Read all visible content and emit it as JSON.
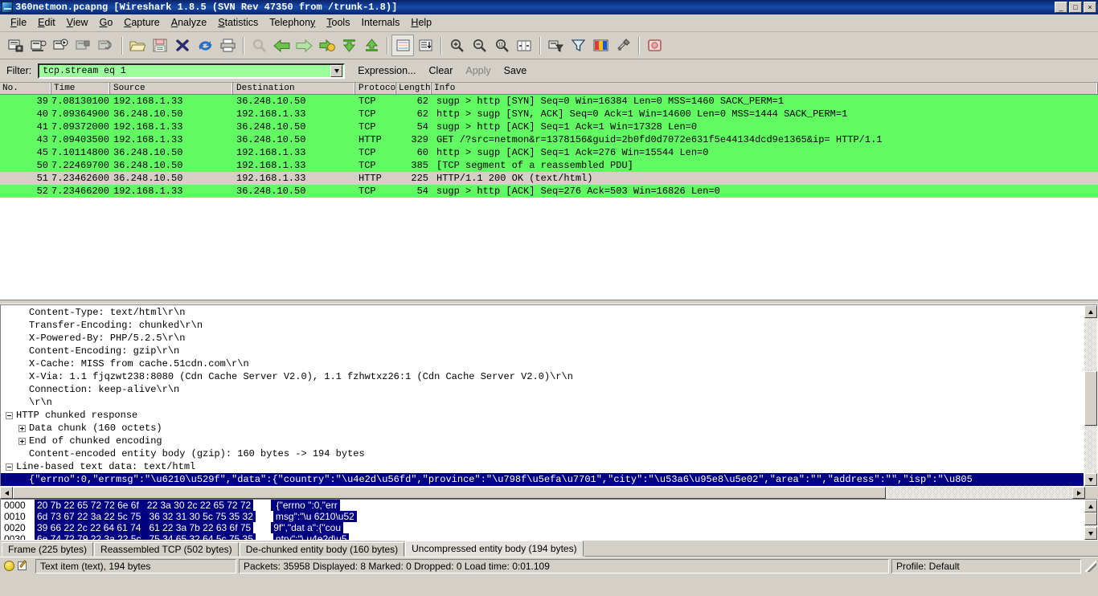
{
  "window": {
    "title": "360netmon.pcapng   [Wireshark 1.8.5  (SVN Rev 47350 from /trunk-1.8)]",
    "minimize_label": "_",
    "maximize_label": "□",
    "close_label": "×"
  },
  "menu": {
    "items": [
      {
        "label": "File",
        "accel": "F"
      },
      {
        "label": "Edit",
        "accel": "E"
      },
      {
        "label": "View",
        "accel": "V"
      },
      {
        "label": "Go",
        "accel": "G"
      },
      {
        "label": "Capture",
        "accel": "C"
      },
      {
        "label": "Analyze",
        "accel": "A"
      },
      {
        "label": "Statistics",
        "accel": "S"
      },
      {
        "label": "Telephony",
        "accel": "T"
      },
      {
        "label": "Tools",
        "accel": "T"
      },
      {
        "label": "Internals",
        "accel": "I"
      },
      {
        "label": "Help",
        "accel": "H"
      }
    ]
  },
  "toolbar": {
    "buttons": [
      {
        "name": "interfaces-icon",
        "title": "List the available capture interfaces"
      },
      {
        "name": "capture-options-icon",
        "title": "Show the capture options"
      },
      {
        "name": "start-capture-icon",
        "title": "Start a new live capture"
      },
      {
        "name": "stop-capture-icon",
        "title": "Stop the running live capture"
      },
      {
        "name": "restart-capture-icon",
        "title": "Restart the running live capture"
      },
      {
        "name": "open-file-icon",
        "title": "Open a capture file"
      },
      {
        "name": "save-file-icon",
        "title": "Save this capture file"
      },
      {
        "name": "close-file-icon",
        "title": "Close this capture file"
      },
      {
        "name": "reload-icon",
        "title": "Reload this capture file"
      },
      {
        "name": "print-icon",
        "title": "Print packets"
      },
      {
        "name": "find-packet-icon",
        "title": "Find a packet"
      },
      {
        "name": "go-back-icon",
        "title": "Go back in packet history"
      },
      {
        "name": "go-forward-icon",
        "title": "Go forward in packet history"
      },
      {
        "name": "go-to-packet-icon",
        "title": "Go to a specific packet"
      },
      {
        "name": "go-first-packet-icon",
        "title": "Go to the first packet"
      },
      {
        "name": "go-last-packet-icon",
        "title": "Go to the last packet"
      },
      {
        "name": "colorize-icon",
        "title": "Colorize packet list"
      },
      {
        "name": "auto-scroll-icon",
        "title": "Auto scroll in live capture"
      },
      {
        "name": "zoom-in-icon",
        "title": "Zoom in"
      },
      {
        "name": "zoom-out-icon",
        "title": "Zoom out"
      },
      {
        "name": "zoom-reset-icon",
        "title": "Normal size"
      },
      {
        "name": "resize-columns-icon",
        "title": "Resize columns"
      },
      {
        "name": "capture-filters-icon",
        "title": "Edit capture filters"
      },
      {
        "name": "display-filters-icon",
        "title": "Edit display filters"
      },
      {
        "name": "coloring-rules-icon",
        "title": "Coloring rules"
      },
      {
        "name": "preferences-icon",
        "title": "Preferences"
      },
      {
        "name": "help-icon",
        "title": "Help contents"
      }
    ]
  },
  "filter": {
    "label": "Filter:",
    "value": "tcp.stream eq 1",
    "placeholder": "",
    "dropdown_icon": "chevron-down-icon",
    "expression_label": "Expression...",
    "clear_label": "Clear",
    "apply_label": "Apply",
    "save_label": "Save",
    "field_bg": "#9cff9c"
  },
  "packet_list": {
    "columns": [
      "No.",
      "Time",
      "Source",
      "Destination",
      "Protocol",
      "Length",
      "Info"
    ],
    "rows": [
      {
        "no": "39",
        "time": "7.08130100",
        "src": "192.168.1.33",
        "dst": "36.248.10.50",
        "proto": "TCP",
        "len": "62",
        "info": "sugp > http [SYN] Seq=0 Win=16384 Len=0 MSS=1460 SACK_PERM=1",
        "color": "green"
      },
      {
        "no": "40",
        "time": "7.09364900",
        "src": "36.248.10.50",
        "dst": "192.168.1.33",
        "proto": "TCP",
        "len": "62",
        "info": "http > sugp [SYN, ACK] Seq=0 Ack=1 Win=14600 Len=0 MSS=1444 SACK_PERM=1",
        "color": "green"
      },
      {
        "no": "41",
        "time": "7.09372000",
        "src": "192.168.1.33",
        "dst": "36.248.10.50",
        "proto": "TCP",
        "len": "54",
        "info": "sugp > http [ACK] Seq=1 Ack=1 Win=17328 Len=0",
        "color": "green"
      },
      {
        "no": "43",
        "time": "7.09403500",
        "src": "192.168.1.33",
        "dst": "36.248.10.50",
        "proto": "HTTP",
        "len": "329",
        "info": "GET /?src=netmon&r=1378156&guid=2b0fd0d7072e631f5e44134dcd9e1365&ip= HTTP/1.1",
        "color": "green"
      },
      {
        "no": "45",
        "time": "7.10114800",
        "src": "36.248.10.50",
        "dst": "192.168.1.33",
        "proto": "TCP",
        "len": "60",
        "info": "http > sugp [ACK] Seq=1 Ack=276 Win=15544 Len=0",
        "color": "green"
      },
      {
        "no": "50",
        "time": "7.22469700",
        "src": "36.248.10.50",
        "dst": "192.168.1.33",
        "proto": "TCP",
        "len": "385",
        "info": "[TCP segment of a reassembled PDU]",
        "color": "green"
      },
      {
        "no": "51",
        "time": "7.23462600",
        "src": "36.248.10.50",
        "dst": "192.168.1.33",
        "proto": "HTTP",
        "len": "225",
        "info": "HTTP/1.1 200 OK  (text/html)",
        "color": "grey"
      },
      {
        "no": "52",
        "time": "7.23466200",
        "src": "192.168.1.33",
        "dst": "36.248.10.50",
        "proto": "TCP",
        "len": "54",
        "info": "sugp > http [ACK] Seq=276 Ack=503 Win=16826 Len=0",
        "color": "green"
      }
    ]
  },
  "detail_tree": {
    "rows": [
      {
        "indent": 1,
        "twisty": "none",
        "text": "Content-Type: text/html\\r\\n",
        "selected": false
      },
      {
        "indent": 1,
        "twisty": "none",
        "text": "Transfer-Encoding: chunked\\r\\n",
        "selected": false
      },
      {
        "indent": 1,
        "twisty": "none",
        "text": "X-Powered-By: PHP/5.2.5\\r\\n",
        "selected": false
      },
      {
        "indent": 1,
        "twisty": "none",
        "text": "Content-Encoding: gzip\\r\\n",
        "selected": false
      },
      {
        "indent": 1,
        "twisty": "none",
        "text": "X-Cache: MISS from cache.51cdn.com\\r\\n",
        "selected": false
      },
      {
        "indent": 1,
        "twisty": "none",
        "text": "X-Via: 1.1 fjqzwt238:8080 (Cdn Cache Server V2.0), 1.1 fzhwtxz26:1 (Cdn Cache Server V2.0)\\r\\n",
        "selected": false
      },
      {
        "indent": 1,
        "twisty": "none",
        "text": "Connection: keep-alive\\r\\n",
        "selected": false
      },
      {
        "indent": 1,
        "twisty": "none",
        "text": "\\r\\n",
        "selected": false
      },
      {
        "indent": 0,
        "twisty": "minus",
        "text": "HTTP chunked response",
        "selected": false
      },
      {
        "indent": 1,
        "twisty": "plus",
        "text": "Data chunk (160 octets)",
        "selected": false
      },
      {
        "indent": 1,
        "twisty": "plus",
        "text": "End of chunked encoding",
        "selected": false
      },
      {
        "indent": 1,
        "twisty": "none",
        "text": "Content-encoded entity body (gzip): 160 bytes -> 194 bytes",
        "selected": false
      },
      {
        "indent": -1,
        "twisty": "minus",
        "text": "Line-based text data: text/html",
        "selected": false
      },
      {
        "indent": 1,
        "twisty": "none",
        "text": "{\"errno\":0,\"errmsg\":\"\\u6210\\u529f\",\"data\":{\"country\":\"\\u4e2d\\u56fd\",\"province\":\"\\u798f\\u5efa\\u7701\",\"city\":\"\\u53a6\\u95e8\\u5e02\",\"area\":\"\",\"address\":\"\",\"isp\":\"\\u805",
        "selected": true
      }
    ]
  },
  "hex_pane": {
    "rows": [
      {
        "offset": "0000",
        "bytes": "20 7b 22 65 72 72 6e 6f   22 3a 30 2c 22 65 72 72",
        "ascii": " {\"errno \":0,\"err"
      },
      {
        "offset": "0010",
        "bytes": "6d 73 67 22 3a 22 5c 75   36 32 31 30 5c 75 35 32",
        "ascii": "msg\":\"\\u 6210\\u52"
      },
      {
        "offset": "0020",
        "bytes": "39 66 22 2c 22 64 61 74   61 22 3a 7b 22 63 6f 75",
        "ascii": "9f\",\"dat a\":{\"cou"
      },
      {
        "offset": "0030",
        "bytes": "6e 74 72 79 22 3a 22 5c   75 34 65 32 64 5c 75 35",
        "ascii": "ntry\":\"\\ u4e2d\\u5"
      }
    ]
  },
  "byte_tabs": {
    "tabs": [
      {
        "label": "Frame (225 bytes)",
        "active": false
      },
      {
        "label": "Reassembled TCP (502 bytes)",
        "active": false
      },
      {
        "label": "De-chunked entity body (160 bytes)",
        "active": false
      },
      {
        "label": "Uncompressed entity body (194 bytes)",
        "active": true
      }
    ]
  },
  "status_bar": {
    "expert_icon": "expert-info-circle-icon",
    "annotation_icon": "capture-comment-icon",
    "field_info": "Text item (text), 194 bytes",
    "packet_counts": "Packets: 35958 Displayed: 8 Marked: 0 Dropped: 0 Load time: 0:01.109",
    "profile": "Profile: Default"
  },
  "colors": {
    "window_bg": "#d4d0c8",
    "title_gradient_start": "#0a246a",
    "packet_green": "#62fa62",
    "packet_grey": "#d4d0c8",
    "selection_blue": "#000080",
    "filter_valid_green": "#9cff9c"
  }
}
